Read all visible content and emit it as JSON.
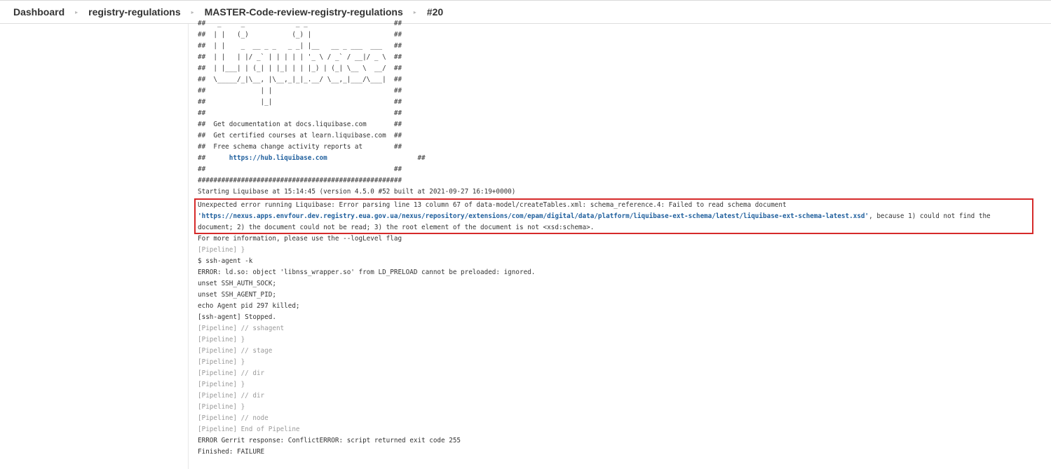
{
  "breadcrumb": {
    "items": [
      "Dashboard",
      "registry-regulations",
      "MASTER-Code-review-registry-regulations",
      "#20"
    ]
  },
  "console": {
    "banner": [
      "##   _     _             _ _                      ##",
      "##  | |   (_)           (_) |                     ##",
      "##  | |    _  __ _ _   _ _| |__   __ _ ___  ___   ##",
      "##  | |   | |/ _` | | | | | '_ \\ / _` / __|/ _ \\  ##",
      "##  | |___| | (_| | |_| | | |_) | (_| \\__ \\  __/  ##",
      "##  \\_____/_|\\__, |\\__,_|_|_.__/ \\__,_|___/\\___|  ##",
      "##              | |                               ##",
      "##              |_|                               ##",
      "##                                                ##",
      "##  Get documentation at docs.liquibase.com       ##",
      "##  Get certified courses at learn.liquibase.com  ##",
      "##  Free schema change activity reports at        ##"
    ],
    "hub_prefix": "##      ",
    "hub_link": "https://hub.liquibase.com",
    "hub_suffix": "                       ##",
    "blank_line": "##                                                ##",
    "hash_line": "####################################################",
    "starting": "Starting Liquibase at 15:14:45 (version 4.5.0 #52 built at 2021-09-27 16:19+0000)",
    "error": {
      "line1": "Unexpected error running Liquibase: Error parsing line 13 column 67 of data-model/createTables.xml: schema_reference.4: Failed to read schema document",
      "link": "'https://nexus.apps.envfour.dev.registry.eua.gov.ua/nexus/repository/extensions/com/epam/digital/data/platform/liquibase-ext-schema/latest/liquibase-ext-schema-latest.xsd'",
      "line2_suffix": ", because 1) could not find the",
      "line3": "document; 2) the document could not be read; 3) the root element of the document is not <xsd:schema>."
    },
    "tail": [
      {
        "text": "For more information, please use the --logLevel flag",
        "pipeline": false
      },
      {
        "text": "[Pipeline] }",
        "pipeline": true
      },
      {
        "text": "$ ssh-agent -k",
        "pipeline": false
      },
      {
        "text": "ERROR: ld.so: object 'libnss_wrapper.so' from LD_PRELOAD cannot be preloaded: ignored.",
        "pipeline": false
      },
      {
        "text": "unset SSH_AUTH_SOCK;",
        "pipeline": false
      },
      {
        "text": "unset SSH_AGENT_PID;",
        "pipeline": false
      },
      {
        "text": "echo Agent pid 297 killed;",
        "pipeline": false
      },
      {
        "text": "[ssh-agent] Stopped.",
        "pipeline": false
      },
      {
        "text": "[Pipeline] // sshagent",
        "pipeline": true
      },
      {
        "text": "[Pipeline] }",
        "pipeline": true
      },
      {
        "text": "[Pipeline] // stage",
        "pipeline": true
      },
      {
        "text": "[Pipeline] }",
        "pipeline": true
      },
      {
        "text": "[Pipeline] // dir",
        "pipeline": true
      },
      {
        "text": "[Pipeline] }",
        "pipeline": true
      },
      {
        "text": "[Pipeline] // dir",
        "pipeline": true
      },
      {
        "text": "[Pipeline] }",
        "pipeline": true
      },
      {
        "text": "[Pipeline] // node",
        "pipeline": true
      },
      {
        "text": "[Pipeline] End of Pipeline",
        "pipeline": true
      },
      {
        "text": "ERROR Gerrit response: ConflictERROR: script returned exit code 255",
        "pipeline": false
      },
      {
        "text": "Finished: FAILURE",
        "pipeline": false
      }
    ]
  },
  "colors": {
    "highlight_border": "#d62a2a",
    "link": "#1f5f9d",
    "pipeline_text": "#9a9a9a"
  }
}
